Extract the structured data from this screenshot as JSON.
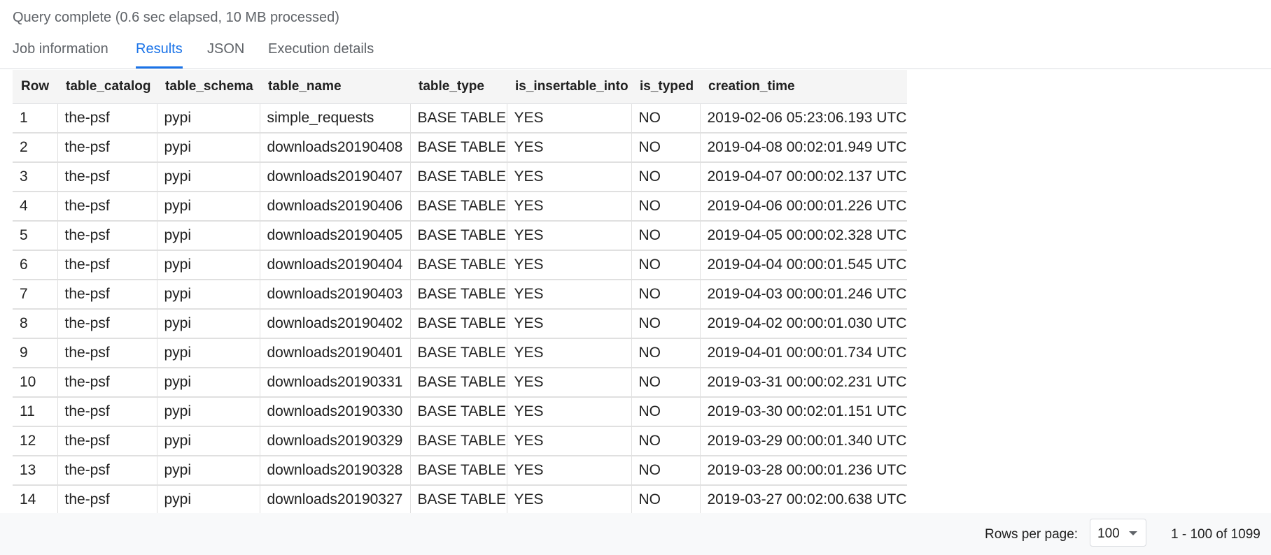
{
  "status_text": "Query complete (0.6 sec elapsed, 10 MB processed)",
  "tabs": [
    {
      "label": "Job information",
      "active": false
    },
    {
      "label": "Results",
      "active": true
    },
    {
      "label": "JSON",
      "active": false
    },
    {
      "label": "Execution details",
      "active": false
    }
  ],
  "table": {
    "columns": [
      "Row",
      "table_catalog",
      "table_schema",
      "table_name",
      "table_type",
      "is_insertable_into",
      "is_typed",
      "creation_time"
    ],
    "rows": [
      [
        "1",
        "the-psf",
        "pypi",
        "simple_requests",
        "BASE TABLE",
        "YES",
        "NO",
        "2019-02-06 05:23:06.193 UTC"
      ],
      [
        "2",
        "the-psf",
        "pypi",
        "downloads20190408",
        "BASE TABLE",
        "YES",
        "NO",
        "2019-04-08 00:02:01.949 UTC"
      ],
      [
        "3",
        "the-psf",
        "pypi",
        "downloads20190407",
        "BASE TABLE",
        "YES",
        "NO",
        "2019-04-07 00:00:02.137 UTC"
      ],
      [
        "4",
        "the-psf",
        "pypi",
        "downloads20190406",
        "BASE TABLE",
        "YES",
        "NO",
        "2019-04-06 00:00:01.226 UTC"
      ],
      [
        "5",
        "the-psf",
        "pypi",
        "downloads20190405",
        "BASE TABLE",
        "YES",
        "NO",
        "2019-04-05 00:00:02.328 UTC"
      ],
      [
        "6",
        "the-psf",
        "pypi",
        "downloads20190404",
        "BASE TABLE",
        "YES",
        "NO",
        "2019-04-04 00:00:01.545 UTC"
      ],
      [
        "7",
        "the-psf",
        "pypi",
        "downloads20190403",
        "BASE TABLE",
        "YES",
        "NO",
        "2019-04-03 00:00:01.246 UTC"
      ],
      [
        "8",
        "the-psf",
        "pypi",
        "downloads20190402",
        "BASE TABLE",
        "YES",
        "NO",
        "2019-04-02 00:00:01.030 UTC"
      ],
      [
        "9",
        "the-psf",
        "pypi",
        "downloads20190401",
        "BASE TABLE",
        "YES",
        "NO",
        "2019-04-01 00:00:01.734 UTC"
      ],
      [
        "10",
        "the-psf",
        "pypi",
        "downloads20190331",
        "BASE TABLE",
        "YES",
        "NO",
        "2019-03-31 00:00:02.231 UTC"
      ],
      [
        "11",
        "the-psf",
        "pypi",
        "downloads20190330",
        "BASE TABLE",
        "YES",
        "NO",
        "2019-03-30 00:02:01.151 UTC"
      ],
      [
        "12",
        "the-psf",
        "pypi",
        "downloads20190329",
        "BASE TABLE",
        "YES",
        "NO",
        "2019-03-29 00:00:01.340 UTC"
      ],
      [
        "13",
        "the-psf",
        "pypi",
        "downloads20190328",
        "BASE TABLE",
        "YES",
        "NO",
        "2019-03-28 00:00:01.236 UTC"
      ],
      [
        "14",
        "the-psf",
        "pypi",
        "downloads20190327",
        "BASE TABLE",
        "YES",
        "NO",
        "2019-03-27 00:02:00.638 UTC"
      ]
    ]
  },
  "pagination": {
    "rows_per_page_label": "Rows per page:",
    "rows_per_page_value": "100",
    "range_text": "1 - 100 of 1099",
    "dropdown_icon": "caret-down-icon"
  },
  "colors": {
    "accent": "#1a73e8",
    "muted_text": "#5f6368",
    "header_bg": "#f5f5f5",
    "footer_bg": "#f8f9fa"
  }
}
